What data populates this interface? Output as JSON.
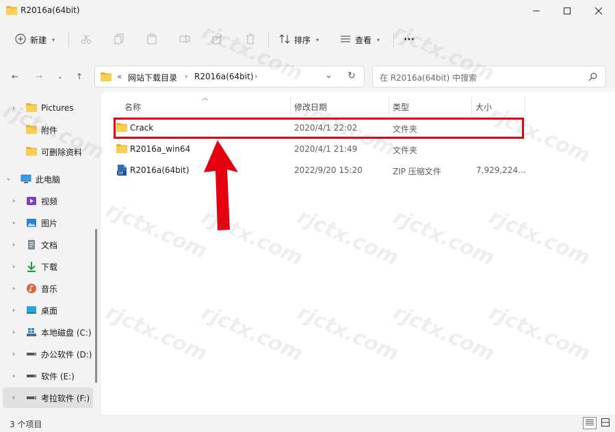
{
  "window": {
    "title": "R2016a(64bit)",
    "controls": {
      "minimize": "—",
      "maximize": "☐",
      "close": "✕"
    }
  },
  "toolbar": {
    "new_label": "新建",
    "sort_label": "排序",
    "view_label": "查看",
    "more_label": "···"
  },
  "nav": {
    "back": "←",
    "forward": "→",
    "recent": "⌄",
    "up": "↑"
  },
  "address": {
    "overflow": "«",
    "parts": [
      "网站下载目录",
      "R2016a(64bit)"
    ],
    "chevron": "›",
    "dropdown": "⌄",
    "refresh": "↻"
  },
  "search": {
    "placeholder": "在 R2016a(64bit) 中搜索"
  },
  "sidebar": {
    "items": [
      {
        "label": "Pictures",
        "icon": "folder-icon"
      },
      {
        "label": "附件",
        "icon": "folder-icon"
      },
      {
        "label": "可删除资料",
        "icon": "folder-icon"
      },
      {
        "label": "此电脑",
        "icon": "computer-icon"
      },
      {
        "label": "视频",
        "icon": "video-icon"
      },
      {
        "label": "图片",
        "icon": "picture-icon"
      },
      {
        "label": "文档",
        "icon": "document-icon"
      },
      {
        "label": "下载",
        "icon": "download-icon"
      },
      {
        "label": "音乐",
        "icon": "music-icon"
      },
      {
        "label": "桌面",
        "icon": "desktop-icon"
      },
      {
        "label": "本地磁盘 (C:)",
        "icon": "drive-icon"
      },
      {
        "label": "办公软件 (D:)",
        "icon": "drive-icon"
      },
      {
        "label": "软件 (E:)",
        "icon": "drive-icon"
      },
      {
        "label": "考拉软件 (F:)",
        "icon": "drive-icon"
      }
    ]
  },
  "columns": {
    "name": "名称",
    "modified": "修改日期",
    "type": "类型",
    "size": "大小"
  },
  "files": [
    {
      "name": "Crack",
      "modified": "2020/4/1 22:02",
      "type": "文件夹",
      "size": "",
      "icon": "folder-icon"
    },
    {
      "name": "R2016a_win64",
      "modified": "2020/4/1 21:49",
      "type": "文件夹",
      "size": "",
      "icon": "folder-icon"
    },
    {
      "name": "R2016a(64bit)",
      "modified": "2022/9/20 15:20",
      "type": "ZIP 压缩文件",
      "size": "7,929,224...",
      "icon": "zip-icon"
    }
  ],
  "status": {
    "item_count": "3 个项目"
  },
  "watermark": "rjctx.com",
  "colors": {
    "highlight": "#e3000f",
    "arrow": "#e3000f",
    "folder": "#f3c640"
  }
}
